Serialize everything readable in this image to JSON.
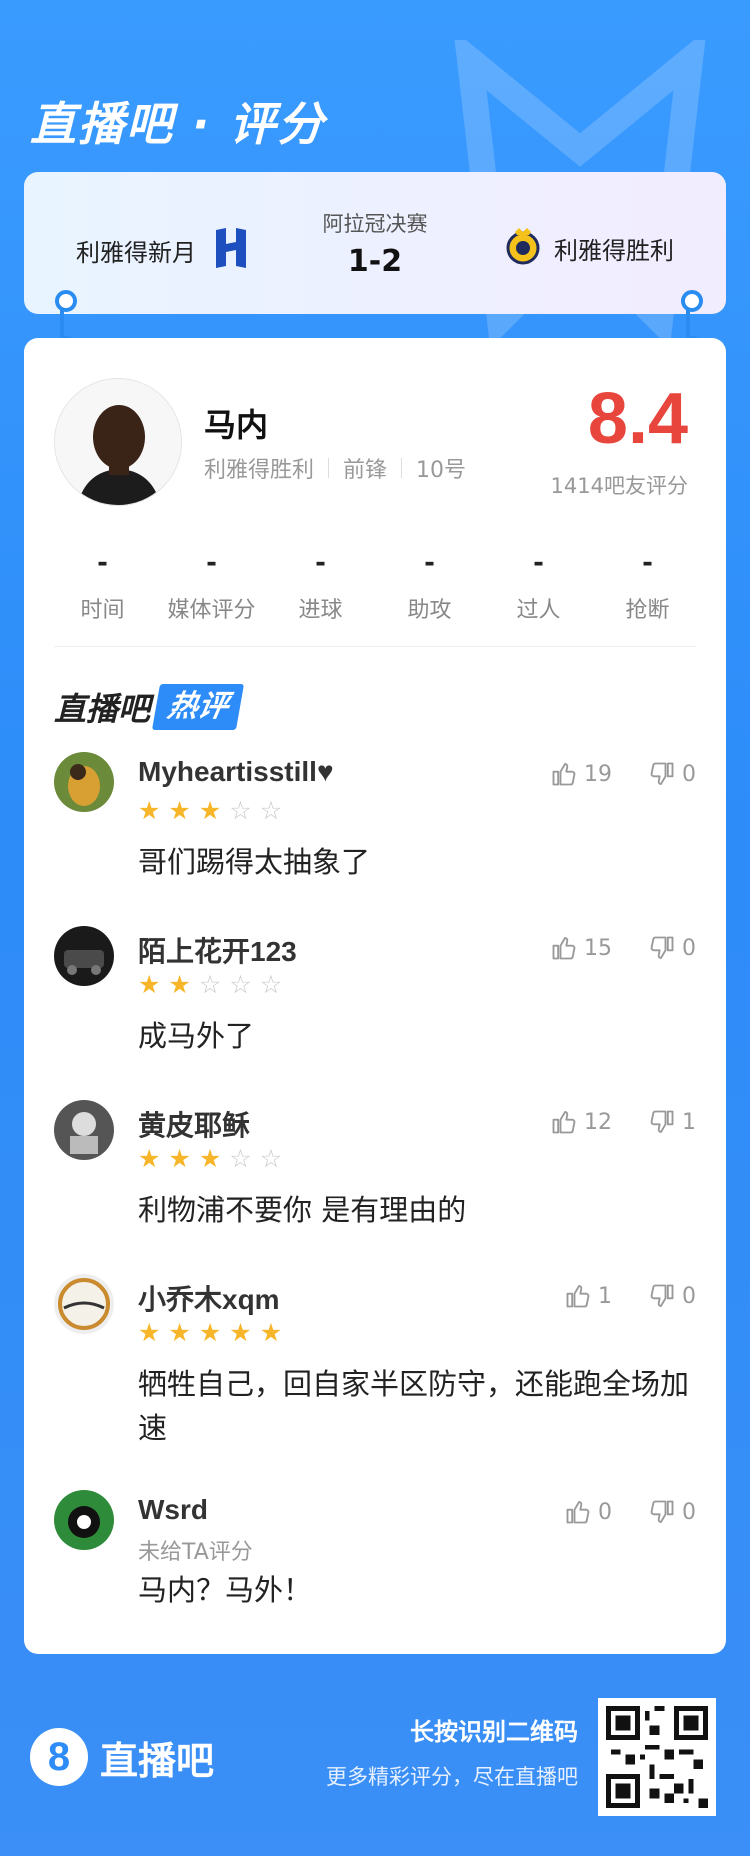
{
  "brand": {
    "title": "直播吧 · 评分"
  },
  "match": {
    "home_team": "利雅得新月",
    "away_team": "利雅得胜利",
    "competition": "阿拉冠决赛",
    "score": "1-2"
  },
  "player": {
    "name": "马内",
    "team": "利雅得胜利",
    "position": "前锋",
    "number": "10号",
    "rating": "8.4",
    "rating_count": "1414吧友评分"
  },
  "stats": [
    {
      "value": "-",
      "label": "时间"
    },
    {
      "value": "-",
      "label": "媒体评分"
    },
    {
      "value": "-",
      "label": "进球"
    },
    {
      "value": "-",
      "label": "助攻"
    },
    {
      "value": "-",
      "label": "过人"
    },
    {
      "value": "-",
      "label": "抢断"
    }
  ],
  "hot_section": {
    "prefix": "直播吧",
    "tag": "热评"
  },
  "comments": [
    {
      "user": "Myheartisstill♥",
      "stars": 3,
      "likes": "19",
      "dislikes": "0",
      "text": "哥们踢得太抽象了"
    },
    {
      "user": "陌上花开123",
      "stars": 2,
      "likes": "15",
      "dislikes": "0",
      "text": "成马外了"
    },
    {
      "user": "黄皮耶稣",
      "stars": 3,
      "likes": "12",
      "dislikes": "1",
      "text": "利物浦不要你 是有理由的"
    },
    {
      "user": "小乔木xqm",
      "stars": 5,
      "likes": "1",
      "dislikes": "0",
      "text": "牺牲自己，回自家半区防守，还能跑全场加速"
    },
    {
      "user": "Wsrd",
      "stars": 0,
      "unrated": "未给TA评分",
      "likes": "0",
      "dislikes": "0",
      "text": "马内？马外！"
    }
  ],
  "footer": {
    "logo_mark": "8",
    "logo_text": "直播吧",
    "scan_hint": "长按识别二维码",
    "slogan": "更多精彩评分，尽在直播吧"
  },
  "colors": {
    "accent": "#2d8cf8",
    "rating": "#e8453c",
    "star": "#f7b529"
  },
  "icons": [
    "thumb-up-icon",
    "thumb-down-icon",
    "qr-code-icon",
    "team-logo-icon"
  ]
}
